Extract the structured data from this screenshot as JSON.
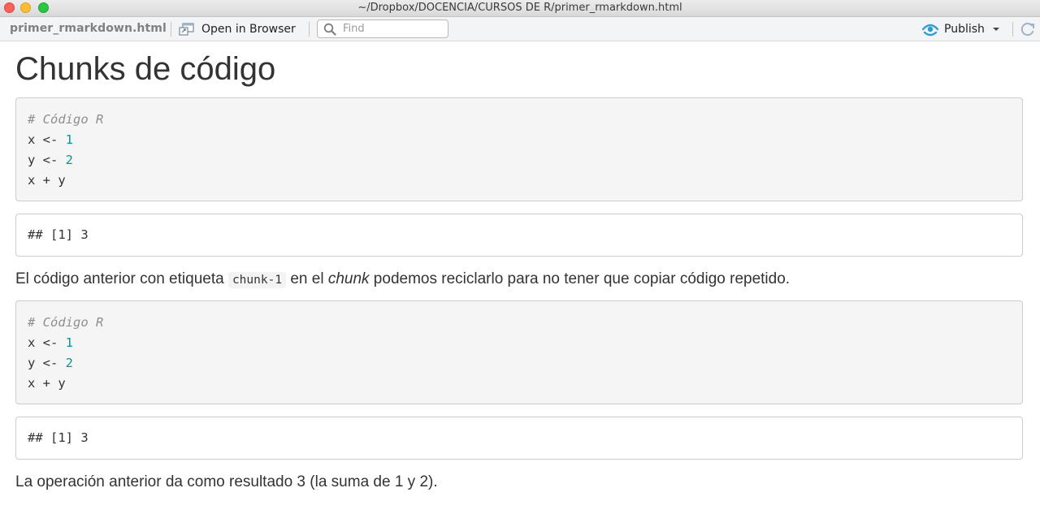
{
  "window": {
    "title": "~/Dropbox/DOCENCIA/CURSOS DE R/primer_rmarkdown.html"
  },
  "toolbar": {
    "filename": "primer_rmarkdown.html",
    "open_in_browser_label": "Open in Browser",
    "find_placeholder": "Find",
    "publish_label": "Publish"
  },
  "document": {
    "heading": "Chunks de código",
    "code_chunks": [
      {
        "comment": "# Código R",
        "line1_var": "x <- ",
        "line1_num": "1",
        "line2_var": "y <- ",
        "line2_num": "2",
        "line3": "x + y"
      },
      {
        "comment": "# Código R",
        "line1_var": "x <- ",
        "line1_num": "1",
        "line2_var": "y <- ",
        "line2_num": "2",
        "line3": "x + y"
      }
    ],
    "outputs": [
      "## [1] 3",
      "## [1] 3"
    ],
    "paragraph1": {
      "before": "El código anterior con etiqueta ",
      "code": "chunk-1",
      "middle": " en el ",
      "emph": "chunk",
      "after": " podemos reciclarlo para no tener que copiar código repetido."
    },
    "paragraph2": "La operación anterior da como resultado 3 (la suma de 1 y 2)."
  },
  "colors": {
    "number_literal": "#009999",
    "comment": "#8f8f8f",
    "publish_icon": "#2a9fd6"
  }
}
